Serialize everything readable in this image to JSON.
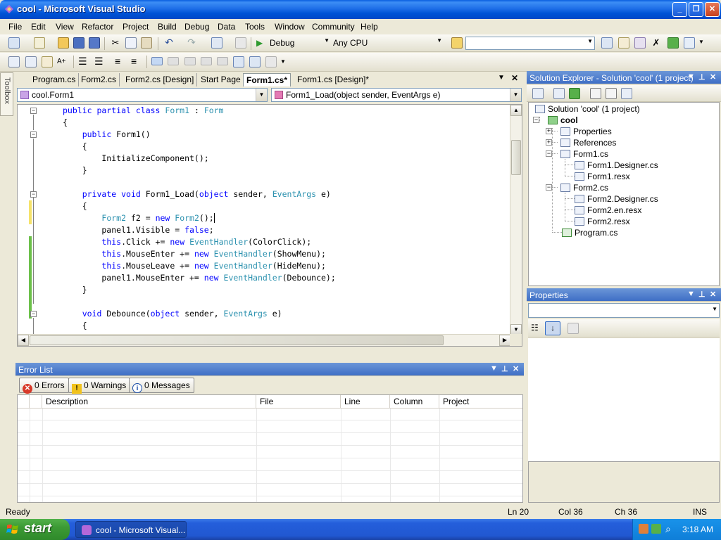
{
  "window": {
    "title": "cool - Microsoft Visual Studio",
    "controls": [
      "minimize",
      "maximize",
      "close"
    ]
  },
  "menu": [
    "File",
    "Edit",
    "View",
    "Refactor",
    "Project",
    "Build",
    "Debug",
    "Data",
    "Tools",
    "Window",
    "Community",
    "Help"
  ],
  "toolbar": {
    "config": "Debug",
    "platform": "Any CPU",
    "find": ""
  },
  "toolbox": {
    "label": "Toolbox"
  },
  "tabs": [
    "Program.cs",
    "Form2.cs",
    "Form2.cs [Design]",
    "Start Page",
    "Form1.cs*",
    "Form1.cs [Design]*"
  ],
  "active_tab": "Form1.cs*",
  "navigation": {
    "type": "cool.Form1",
    "member": "Form1_Load(object sender, EventArgs e)"
  },
  "code_lines": [
    "public partial class Form1 : Form",
    "{",
    "    public Form1()",
    "    {",
    "        InitializeComponent();",
    "    }",
    "",
    "    private void Form1_Load(object sender, EventArgs e)",
    "    {",
    "        Form2 f2 = new Form2();",
    "        panel1.Visible = false;",
    "        this.Click += new EventHandler(ColorClick);",
    "        this.MouseEnter += new EventHandler(ShowMenu);",
    "        this.MouseLeave += new EventHandler(HideMenu);",
    "        panel1.MouseEnter += new EventHandler(Debounce);",
    "    }",
    "",
    "    void Debounce(object sender, EventArgs e)",
    "    {"
  ],
  "solution_explorer": {
    "title": "Solution Explorer - Solution 'cool' (1 project)",
    "items": [
      {
        "label": "Solution 'cool' (1 project)",
        "level": 0,
        "icon": "solution-icon"
      },
      {
        "label": "cool",
        "level": 1,
        "icon": "csharp-project-icon",
        "bold": true
      },
      {
        "label": "Properties",
        "level": 2,
        "icon": "properties-folder-icon"
      },
      {
        "label": "References",
        "level": 2,
        "icon": "references-folder-icon"
      },
      {
        "label": "Form1.cs",
        "level": 2,
        "icon": "form-icon"
      },
      {
        "label": "Form1.Designer.cs",
        "level": 3,
        "icon": "cs-file-icon"
      },
      {
        "label": "Form1.resx",
        "level": 3,
        "icon": "resx-file-icon"
      },
      {
        "label": "Form2.cs",
        "level": 2,
        "icon": "form-icon"
      },
      {
        "label": "Form2.Designer.cs",
        "level": 3,
        "icon": "cs-file-icon"
      },
      {
        "label": "Form2.en.resx",
        "level": 3,
        "icon": "resx-file-icon"
      },
      {
        "label": "Form2.resx",
        "level": 3,
        "icon": "resx-file-icon"
      },
      {
        "label": "Program.cs",
        "level": 2,
        "icon": "cs-file-icon"
      }
    ]
  },
  "properties": {
    "title": "Properties",
    "object": ""
  },
  "error_list": {
    "title": "Error List",
    "errors": "0 Errors",
    "warnings": "0 Warnings",
    "messages": "0 Messages",
    "columns": [
      "",
      "Description",
      "File",
      "Line",
      "Column",
      "Project"
    ]
  },
  "status": {
    "text": "Ready",
    "ln": "Ln 20",
    "col": "Col 36",
    "ch": "Ch 36",
    "mode": "INS"
  },
  "taskbar": {
    "start": "start",
    "task": "cool - Microsoft Visual...",
    "clock": "3:18 AM"
  },
  "colors": {
    "keyword": "#0000ff",
    "type": "#2b91af",
    "title_bar": "#0053d6",
    "changed_line": "#f5e26a",
    "saved_line": "#6cc04a"
  }
}
